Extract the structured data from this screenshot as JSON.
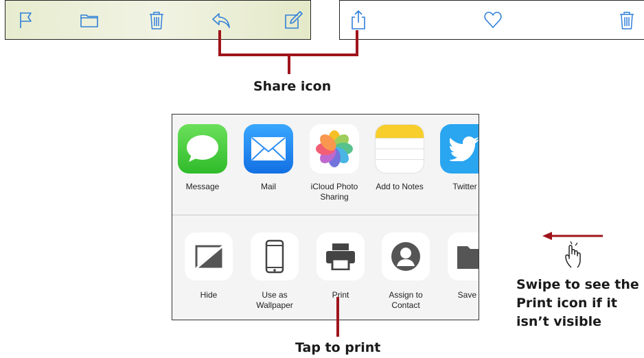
{
  "annotations": {
    "share_icon": "Share icon",
    "tap_to_print": "Tap to print",
    "swipe_line1": "Swipe to see the",
    "swipe_line2": "Print icon if it",
    "swipe_line3": "isn’t visible"
  },
  "toolbar_left_icons": [
    "flag-icon",
    "folder-icon",
    "trash-icon",
    "reply-icon",
    "compose-icon"
  ],
  "toolbar_right_icons": [
    "share-icon",
    "heart-icon",
    "trash-icon"
  ],
  "share_sheet": {
    "apps": [
      {
        "label": "Message",
        "icon": "message-icon",
        "color": "#4cd137"
      },
      {
        "label": "Mail",
        "icon": "mail-icon",
        "color": "#1e8ff0"
      },
      {
        "label": "iCloud Photo Sharing",
        "icon": "photos-icon",
        "color": "#ffffff"
      },
      {
        "label": "Add to Notes",
        "icon": "notes-icon",
        "color": "#ffffff"
      },
      {
        "label": "Twitter",
        "icon": "twitter-icon",
        "color": "#1da1f2"
      }
    ],
    "actions": [
      {
        "label": "Hide",
        "icon": "hide-icon"
      },
      {
        "label": "Use as Wallpaper",
        "icon": "phone-icon"
      },
      {
        "label": "Print",
        "icon": "printer-icon"
      },
      {
        "label": "Assign to Contact",
        "icon": "contact-icon"
      },
      {
        "label": "Save to",
        "icon": "folder-icon"
      }
    ]
  },
  "colors": {
    "accent_red": "#a0141b",
    "ios_blue": "#2f7fd8"
  }
}
